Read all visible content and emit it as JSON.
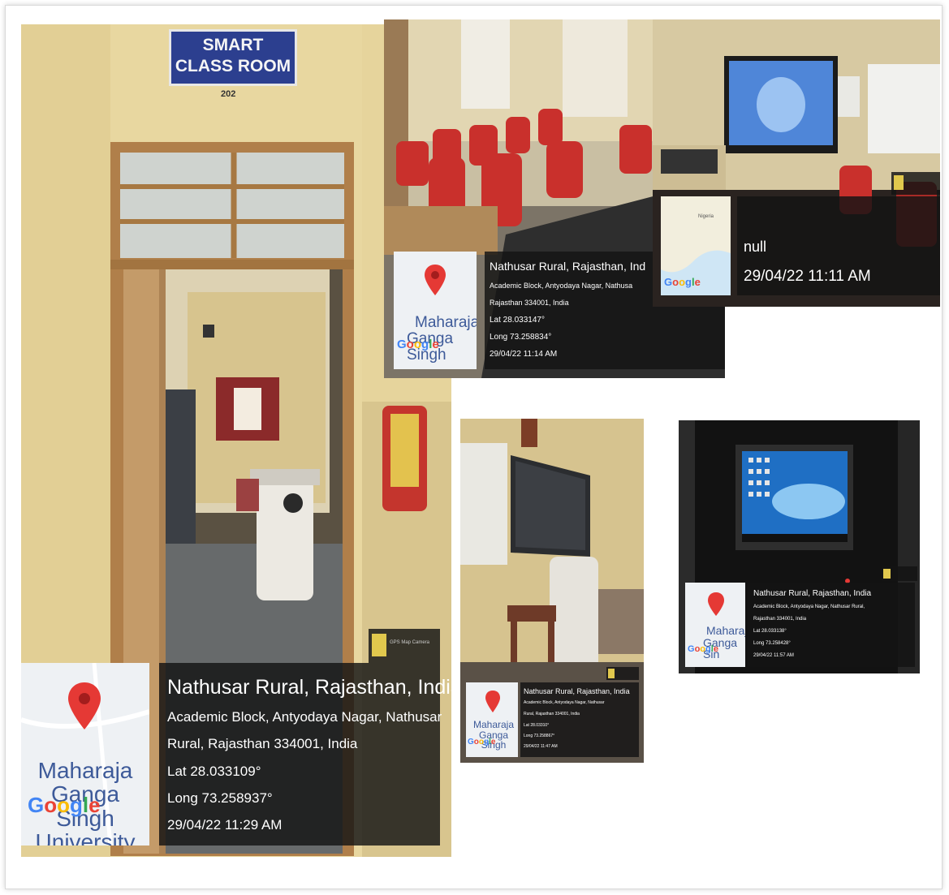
{
  "door_sign": {
    "line1": "SMART",
    "line2": "CLASS ROOM",
    "room_number": "202"
  },
  "google_logo": "Google",
  "camera_app": "GPS Map Camera",
  "photo_main": {
    "place": "Nathusar Rural, Rajasthan, India",
    "address_line1": "Academic Block, Antyodaya Nagar, Nathusar",
    "address_line2": "Rural, Rajasthan 334001, India",
    "lat": "Lat 28.033109°",
    "long": "Long 73.258937°",
    "datetime": "29/04/22 11:29 AM",
    "map_label_1": "Maharaja",
    "map_label_2": "Ganga Singh",
    "map_label_3": "University"
  },
  "photo_top_middle": {
    "place": "Nathusar Rural, Rajasthan, Ind",
    "address_line1": "Academic Block, Antyodaya Nagar, Nathusa",
    "address_line2": "Rajasthan 334001, India",
    "lat": "Lat 28.033147°",
    "long": "Long 73.258834°",
    "datetime": "29/04/22 11:14 AM",
    "map_label_1": "Maharaja",
    "map_label_2": "Ganga Singh"
  },
  "photo_top_right": {
    "place": "null",
    "datetime": "29/04/22 11:11 AM",
    "map_label": "Nigeria"
  },
  "photo_bottom_middle": {
    "place": "Nathusar Rural, Rajasthan, India",
    "address_line1": "Academic Block, Antyodaya Nagar, Nathusar",
    "address_line2": "Rural, Rajasthan 334001, India",
    "lat": "Lat 28.03310°",
    "long": "Long 73.258867°",
    "datetime": "29/04/22 11:47 AM",
    "map_label_1": "Maharaja",
    "map_label_2": "Ganga Singh"
  },
  "photo_bottom_right": {
    "place": "Nathusar Rural, Rajasthan, India",
    "address_line1": "Academic Block, Antyodaya Nagar, Nathusar Rural,",
    "address_line2": "Rajasthan 334001, India",
    "lat": "Lat 28.033138°",
    "long": "Long 73.258428°",
    "datetime": "29/04/22 11:57 AM",
    "map_label_1": "Maharaja",
    "map_label_2": "Ganga Sin"
  },
  "colors": {
    "stamp_bg": "#1a1a1a",
    "pin": "#e53935",
    "wall": "#e9d9a6",
    "chair": "#c9302c",
    "sign": "#2c3f8f"
  }
}
